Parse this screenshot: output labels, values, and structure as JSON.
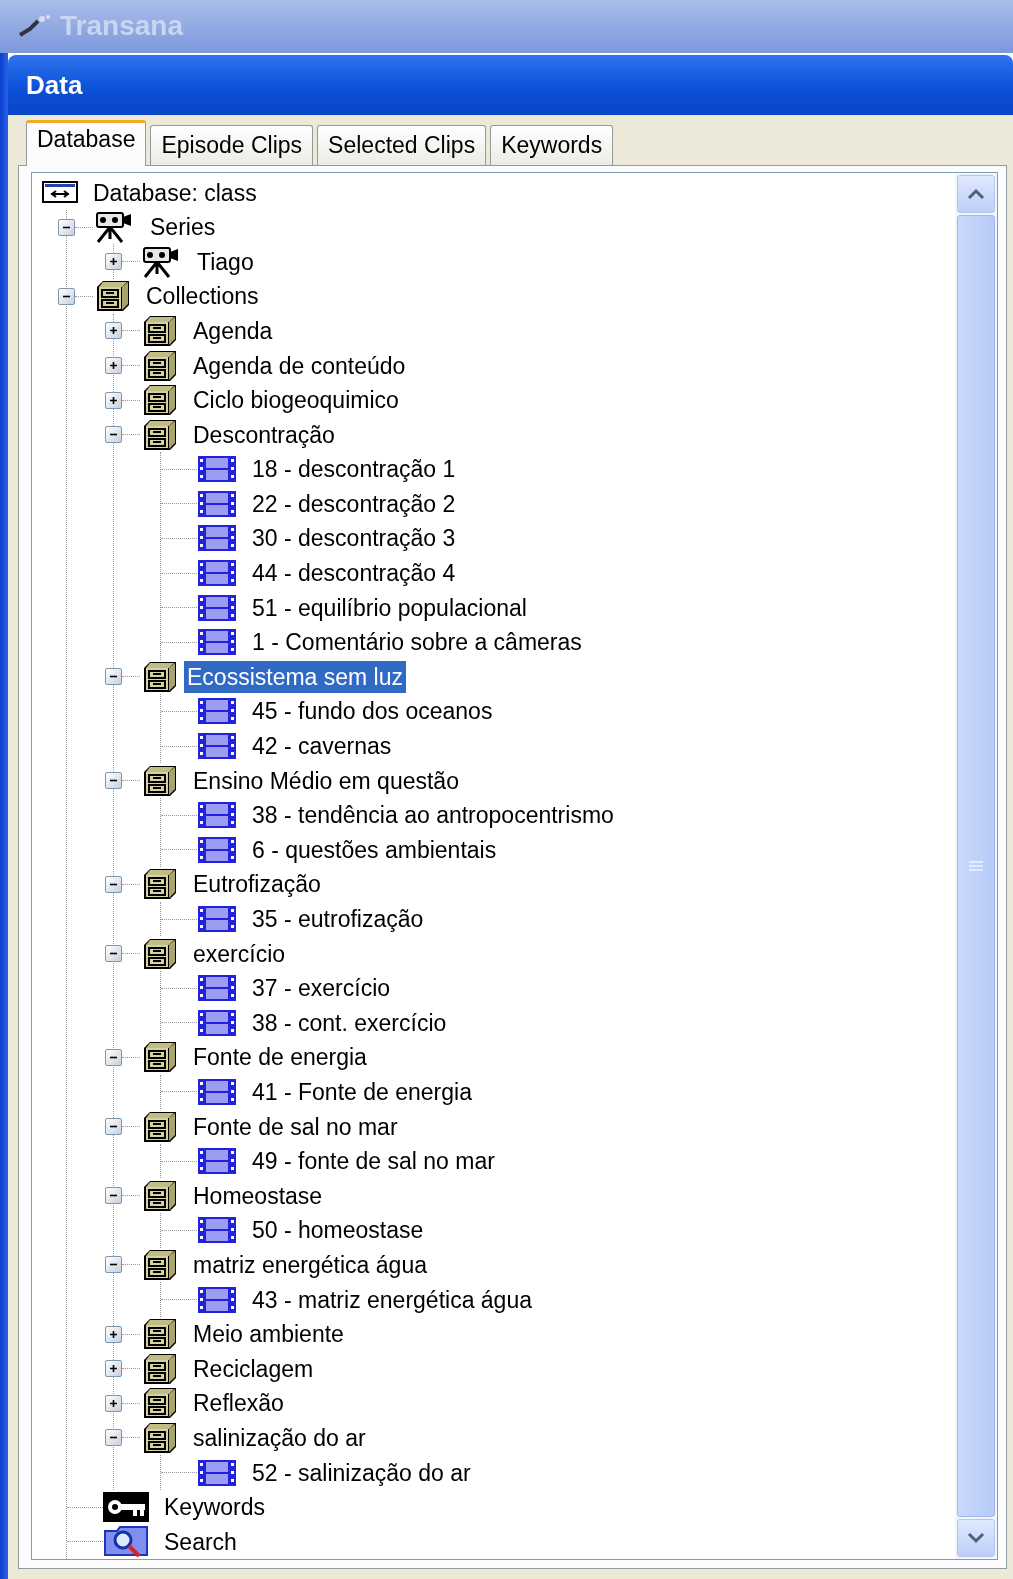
{
  "app_title": "Transana",
  "panel_title": "Data",
  "tabs": [
    {
      "label": "Database",
      "selected": true
    },
    {
      "label": "Episode Clips",
      "selected": false
    },
    {
      "label": "Selected Clips",
      "selected": false
    },
    {
      "label": "Keywords",
      "selected": false
    }
  ],
  "tree": {
    "kind": "database",
    "label": "Database: class",
    "selected": false,
    "children": [
      {
        "kind": "series",
        "label": "Series",
        "expanded": true,
        "selected": false,
        "children": [
          {
            "kind": "series",
            "label": "Tiago",
            "expanded": false,
            "selected": false
          }
        ]
      },
      {
        "kind": "collection",
        "label": "Collections",
        "expanded": true,
        "selected": false,
        "children": [
          {
            "kind": "collection",
            "label": "Agenda",
            "expanded": false,
            "selected": false
          },
          {
            "kind": "collection",
            "label": "Agenda de conteúdo",
            "expanded": false,
            "selected": false
          },
          {
            "kind": "collection",
            "label": "Ciclo biogeoquimico",
            "expanded": false,
            "selected": false
          },
          {
            "kind": "collection",
            "label": "Descontração",
            "expanded": true,
            "selected": false,
            "children": [
              {
                "kind": "clip",
                "label": "18 - descontração 1",
                "selected": false
              },
              {
                "kind": "clip",
                "label": "22 - descontração 2",
                "selected": false
              },
              {
                "kind": "clip",
                "label": "30 - descontração 3",
                "selected": false
              },
              {
                "kind": "clip",
                "label": "44 - descontração 4",
                "selected": false
              },
              {
                "kind": "clip",
                "label": "51 - equilíbrio populacional",
                "selected": false
              },
              {
                "kind": "clip",
                "label": "1 - Comentário sobre a câmeras",
                "selected": false
              }
            ]
          },
          {
            "kind": "collection",
            "label": "Ecossistema sem luz",
            "expanded": true,
            "selected": true,
            "children": [
              {
                "kind": "clip",
                "label": "45 - fundo dos oceanos",
                "selected": false
              },
              {
                "kind": "clip",
                "label": "42 - cavernas",
                "selected": false
              }
            ]
          },
          {
            "kind": "collection",
            "label": "Ensino Médio em questão",
            "expanded": true,
            "selected": false,
            "children": [
              {
                "kind": "clip",
                "label": "38 - tendência ao antropocentrismo",
                "selected": false
              },
              {
                "kind": "clip",
                "label": "6 - questões ambientais",
                "selected": false
              }
            ]
          },
          {
            "kind": "collection",
            "label": "Eutrofização",
            "expanded": true,
            "selected": false,
            "children": [
              {
                "kind": "clip",
                "label": "35 - eutrofização",
                "selected": false
              }
            ]
          },
          {
            "kind": "collection",
            "label": "exercício",
            "expanded": true,
            "selected": false,
            "children": [
              {
                "kind": "clip",
                "label": "37 - exercício",
                "selected": false
              },
              {
                "kind": "clip",
                "label": "38 - cont. exercício",
                "selected": false
              }
            ]
          },
          {
            "kind": "collection",
            "label": "Fonte de energia",
            "expanded": true,
            "selected": false,
            "children": [
              {
                "kind": "clip",
                "label": "41 - Fonte de energia",
                "selected": false
              }
            ]
          },
          {
            "kind": "collection",
            "label": "Fonte de sal no mar",
            "expanded": true,
            "selected": false,
            "children": [
              {
                "kind": "clip",
                "label": "49 - fonte de sal no mar",
                "selected": false
              }
            ]
          },
          {
            "kind": "collection",
            "label": "Homeostase",
            "expanded": true,
            "selected": false,
            "children": [
              {
                "kind": "clip",
                "label": "50 - homeostase",
                "selected": false
              }
            ]
          },
          {
            "kind": "collection",
            "label": "matriz energética água",
            "expanded": true,
            "selected": false,
            "children": [
              {
                "kind": "clip",
                "label": "43 - matriz energética água",
                "selected": false
              }
            ]
          },
          {
            "kind": "collection",
            "label": "Meio ambiente",
            "expanded": false,
            "selected": false
          },
          {
            "kind": "collection",
            "label": "Reciclagem",
            "expanded": false,
            "selected": false
          },
          {
            "kind": "collection",
            "label": "Reflexão",
            "expanded": false,
            "selected": false
          },
          {
            "kind": "collection",
            "label": "salinização do ar",
            "expanded": true,
            "selected": false,
            "children": [
              {
                "kind": "clip",
                "label": "52 - salinização do ar",
                "selected": false
              }
            ]
          }
        ]
      },
      {
        "kind": "keywords",
        "label": "Keywords",
        "selected": false
      },
      {
        "kind": "search",
        "label": "Search",
        "selected": false
      }
    ]
  }
}
